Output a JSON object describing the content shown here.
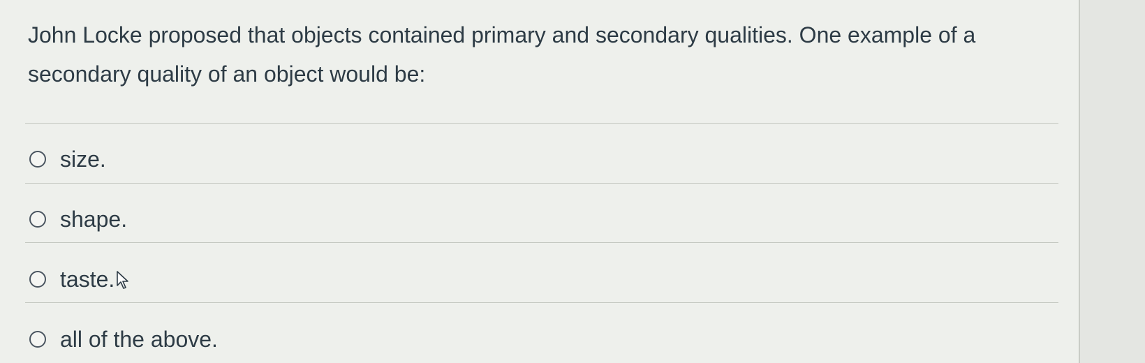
{
  "question": {
    "text": "John Locke proposed that objects contained primary and secondary qualities. One example of a secondary quality of an object would be:"
  },
  "answers": [
    {
      "label": "size."
    },
    {
      "label": "shape."
    },
    {
      "label": "taste."
    },
    {
      "label": "all of the above."
    }
  ],
  "cursor": {
    "icon": "mouse-pointer-icon"
  },
  "colors": {
    "text": "#2d3b45",
    "background": "#eef0ec",
    "divider": "#c4c8c1"
  }
}
